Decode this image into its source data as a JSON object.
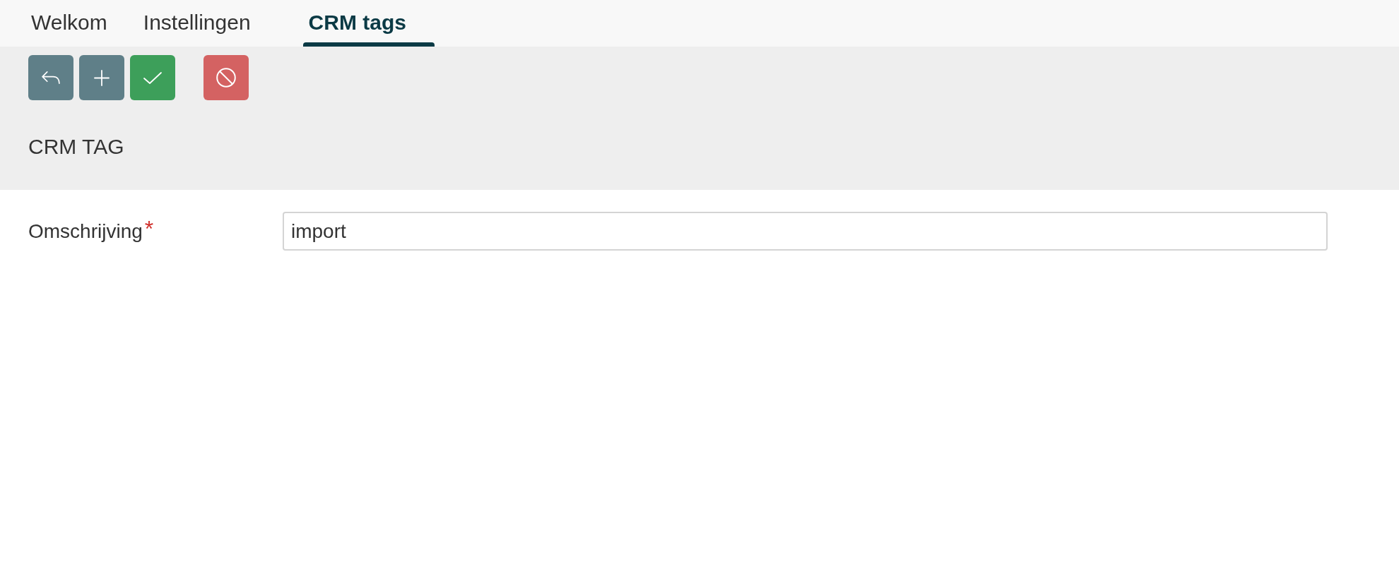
{
  "tabs": [
    {
      "label": "Welkom",
      "selected": false
    },
    {
      "label": "Instellingen",
      "selected": false
    },
    {
      "label": "CRM tags",
      "selected": true
    }
  ],
  "toolbar": {
    "groups": [
      [
        {
          "kind": "back"
        },
        {
          "kind": "add"
        },
        {
          "kind": "save"
        }
      ],
      [
        {
          "kind": "cancel"
        }
      ]
    ]
  },
  "header": {
    "title": "CRM TAG"
  },
  "form": {
    "fields": [
      {
        "label": "Omschrijving",
        "required": true,
        "required_mark": "*",
        "value": "import"
      }
    ]
  }
}
